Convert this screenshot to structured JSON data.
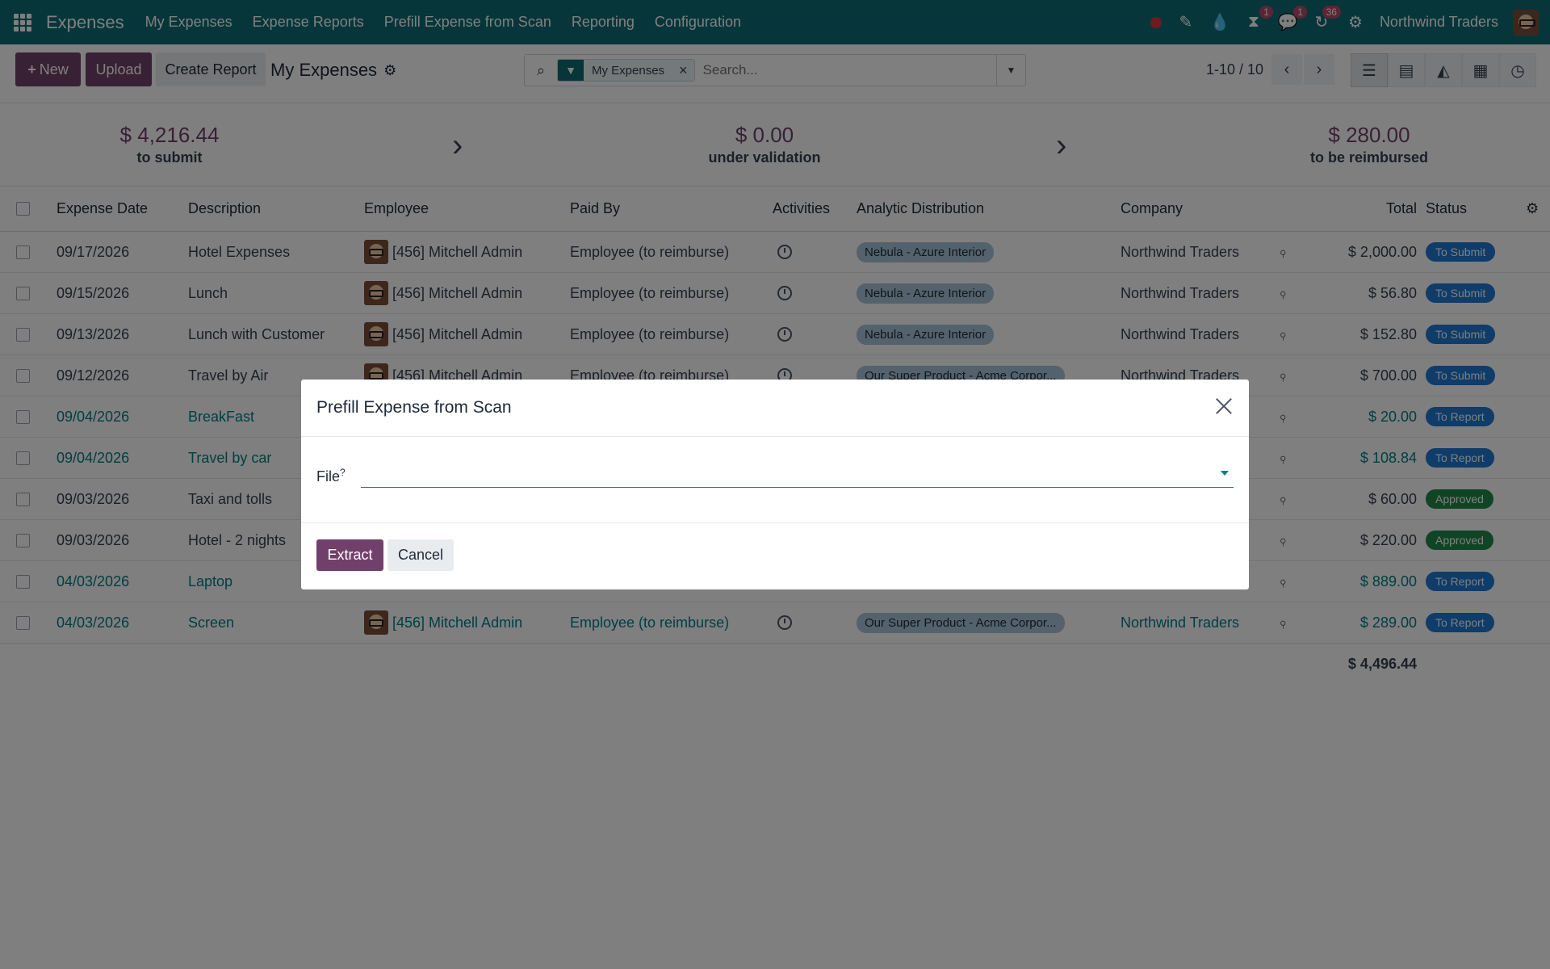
{
  "navbar": {
    "brand": "Expenses",
    "menu": [
      "My Expenses",
      "Expense Reports",
      "Prefill Expense from Scan",
      "Reporting",
      "Configuration"
    ],
    "badges": {
      "activity": "1",
      "messages": "1",
      "updates": "36"
    },
    "company": "Northwind Traders"
  },
  "control_panel": {
    "new_label": "New",
    "upload_label": "Upload",
    "create_report_label": "Create Report",
    "title": "My Expenses",
    "facet_label": "My Expenses",
    "search_placeholder": "Search...",
    "pager": "1-10 / 10"
  },
  "summary": {
    "to_submit_amount": "$ 4,216.44",
    "to_submit_label": "to submit",
    "under_validation_amount": "$ 0.00",
    "under_validation_label": "under validation",
    "reimbursed_amount": "$ 280.00",
    "reimbursed_label": "to be reimbursed"
  },
  "table": {
    "headers": {
      "date": "Expense Date",
      "description": "Description",
      "employee": "Employee",
      "paid_by": "Paid By",
      "activities": "Activities",
      "analytic": "Analytic Distribution",
      "company": "Company",
      "total": "Total",
      "status": "Status"
    },
    "rows": [
      {
        "date": "09/17/2026",
        "description": "Hotel Expenses",
        "employee": "[456] Mitchell Admin",
        "paid_by": "Employee (to reimburse)",
        "analytic": "Nebula - Azure Interior",
        "company": "Northwind Traders",
        "total": "$ 2,000.00",
        "status": "To Submit"
      },
      {
        "date": "09/15/2026",
        "description": "Lunch",
        "employee": "[456] Mitchell Admin",
        "paid_by": "Employee (to reimburse)",
        "analytic": "Nebula - Azure Interior",
        "company": "Northwind Traders",
        "total": "$ 56.80",
        "status": "To Submit"
      },
      {
        "date": "09/13/2026",
        "description": "Lunch with Customer",
        "employee": "[456] Mitchell Admin",
        "paid_by": "Employee (to reimburse)",
        "analytic": "Nebula - Azure Interior",
        "company": "Northwind Traders",
        "total": "$ 152.80",
        "status": "To Submit"
      },
      {
        "date": "09/12/2026",
        "description": "Travel by Air",
        "employee": "[456] Mitchell Admin",
        "paid_by": "Employee (to reimburse)",
        "analytic": "Our Super Product - Acme Corpor...",
        "company": "Northwind Traders",
        "total": "$ 700.00",
        "status": "To Submit"
      },
      {
        "date": "09/04/2026",
        "description": "BreakFast",
        "employee": "",
        "paid_by": "",
        "analytic": "",
        "company": "",
        "total": "$ 20.00",
        "status": "To Report"
      },
      {
        "date": "09/04/2026",
        "description": "Travel by car",
        "employee": "",
        "paid_by": "",
        "analytic": "",
        "company": "",
        "total": "$ 108.84",
        "status": "To Report"
      },
      {
        "date": "09/03/2026",
        "description": "Taxi and tolls",
        "employee": "",
        "paid_by": "",
        "analytic": "",
        "company": "",
        "total": "$ 60.00",
        "status": "Approved"
      },
      {
        "date": "09/03/2026",
        "description": "Hotel - 2 nights",
        "employee": "",
        "paid_by": "",
        "analytic": "",
        "company": "",
        "total": "$ 220.00",
        "status": "Approved"
      },
      {
        "date": "04/03/2026",
        "description": "Laptop",
        "employee": "",
        "paid_by": "",
        "analytic": "",
        "company": "",
        "total": "$ 889.00",
        "status": "To Report"
      },
      {
        "date": "04/03/2026",
        "description": "Screen",
        "employee": "[456] Mitchell Admin",
        "paid_by": "Employee (to reimburse)",
        "analytic": "Our Super Product - Acme Corpor...",
        "company": "Northwind Traders",
        "total": "$ 289.00",
        "status": "To Report"
      }
    ],
    "grand_total": "$ 4,496.44"
  },
  "modal": {
    "title": "Prefill Expense from Scan",
    "file_label": "File",
    "file_help": "?",
    "extract_label": "Extract",
    "cancel_label": "Cancel"
  },
  "colors": {
    "navbar": "#0c6d74",
    "primary": "#71406a",
    "link": "#017e84",
    "status_blue": "#1f78d1",
    "status_green": "#1e8a4a"
  }
}
